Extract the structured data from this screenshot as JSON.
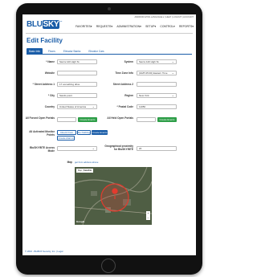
{
  "header": {
    "util_links": "ANDROID HTML LANGUAGE ▾  |  HELP  |  LOGOUT  |  ACCOUNT",
    "logo_a": "BLU",
    "logo_b": "SKY",
    "logo_tm": "™",
    "nav": [
      "FAVORITES▾",
      "REQUESTS▾",
      "ADMINISTRATION▾",
      "SETUP▾",
      "CONTROL▾",
      "REPORTS▾"
    ]
  },
  "page": {
    "title": "Edit Facility",
    "tabs": [
      "Basic Info",
      "Floors",
      "Elevator Banks",
      "Elevator Cars"
    ]
  },
  "form": {
    "name_label": "* Name",
    "name_value": "Sierra 120 High St.",
    "system_label": "System",
    "system_value": "Sierra 120 High St.",
    "website_label": "Website",
    "website_value": "",
    "timezone_label": "Time Zone Info",
    "timezone_value": "(GMT-05:00) Eastern Time",
    "street1_label": "* Street Address 1",
    "street1_value": "17 something drive",
    "street2_label": "Street Address 2",
    "street2_value": "",
    "city_label": "* City",
    "city_value": "Sands point",
    "region_label": "Region",
    "region_value": "New York",
    "country_label": "Country",
    "country_value": "United States of America",
    "postal_label": "* Postal Code",
    "postal_value": "11050",
    "forced_open_label": "All Forced Open Portals",
    "forced_open_value": "",
    "create_events_label": "Create Events",
    "held_open_label": "All Held Open Portals",
    "held_open_value": "",
    "activated_label": "All Activated Monitor Points",
    "inherit_label": "Inherit From System",
    "do_nothing_label": "Do Nothing",
    "create_alarms_label": "Create Alarms",
    "access_mode_label": "BluSKY/BTE Access Mode",
    "access_mode_value": "",
    "proximity_label": "Geographical proximity for BluSKY/BTE",
    "proximity_value": "20",
    "map_label": "Map",
    "map_link": "get from address above",
    "map_type_map": "Map",
    "map_type_sat": "Satellite",
    "map_brand": "Google"
  },
  "footer": {
    "text": "© 2016 - BluBOX Security, Inc. | Legal"
  }
}
